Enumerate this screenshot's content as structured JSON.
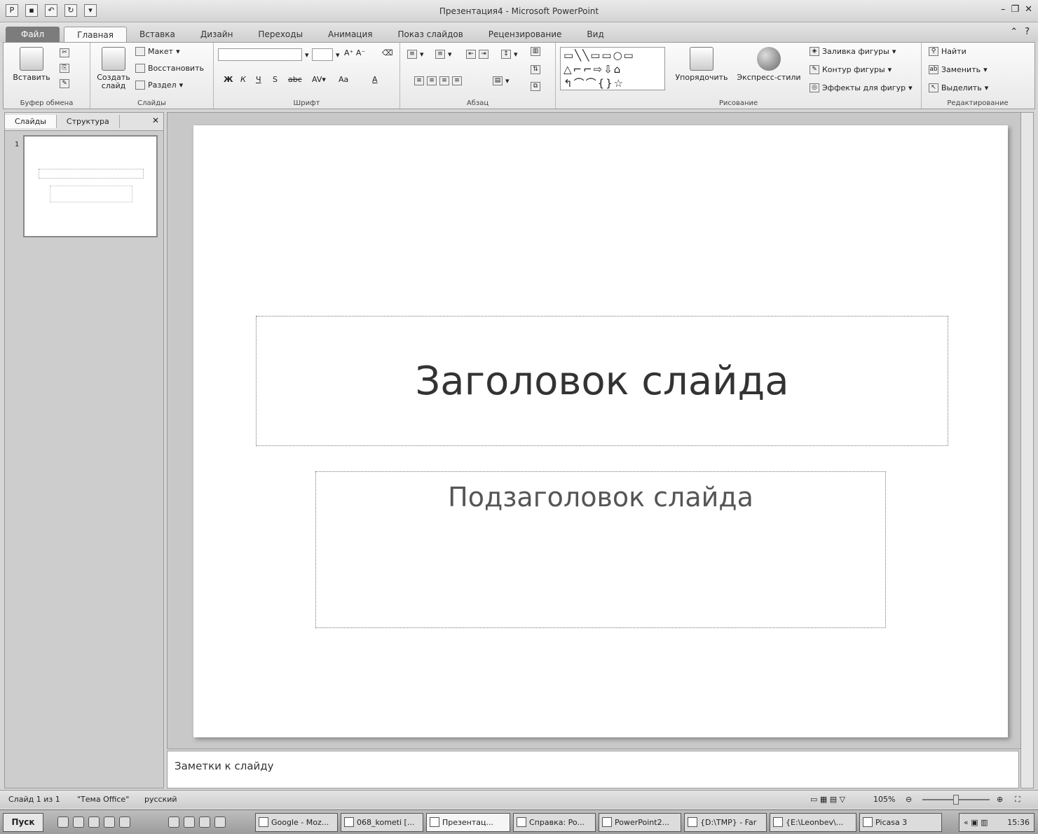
{
  "window": {
    "title": "Презентация4 - Microsoft PowerPoint",
    "controls": [
      "–",
      "❐",
      "✕"
    ]
  },
  "tabs": [
    "Файл",
    "Главная",
    "Вставка",
    "Дизайн",
    "Переходы",
    "Анимация",
    "Показ слайдов",
    "Рецензирование",
    "Вид"
  ],
  "active_tab": "Главная",
  "ribbon": {
    "clipboard": {
      "label": "Буфер обмена",
      "paste": "Вставить"
    },
    "slides": {
      "label": "Слайды",
      "new_slide_line1": "Создать",
      "new_slide_line2": "слайд",
      "layout": "Макет",
      "reset": "Восстановить",
      "section": "Раздел"
    },
    "font": {
      "label": "Шрифт",
      "bold": "Ж",
      "italic": "К",
      "underline": "Ч",
      "strike": "S",
      "change_case": "Аа",
      "font_color": "А"
    },
    "paragraph": {
      "label": "Абзац"
    },
    "drawing": {
      "label": "Рисование",
      "arrange": "Упорядочить",
      "quick_styles": "Экспресс-стили",
      "fill": "Заливка фигуры",
      "outline": "Контур фигуры",
      "effects": "Эффекты для фигур",
      "shapes_glyphs": "▭╲╲▭▭○▭ △⌐⌐⇨⇩⌂ ↰⌒⌒{}☆"
    },
    "editing": {
      "label": "Редактирование",
      "find": "Найти",
      "replace": "Заменить",
      "select": "Выделить"
    }
  },
  "leftpane": {
    "tabs": [
      "Слайды",
      "Структура"
    ],
    "close": "✕",
    "thumb_number": "1"
  },
  "slide": {
    "title_placeholder": "Заголовок слайда",
    "subtitle_placeholder": "Подзаголовок слайда"
  },
  "notes": {
    "placeholder": "Заметки к слайду"
  },
  "status": {
    "slide_info": "Слайд 1 из 1",
    "theme": "\"Тема Office\"",
    "language": "русский",
    "zoom": "105%",
    "zoom_level_percent": 105
  },
  "taskbar": {
    "start": "Пуск",
    "tasks": [
      "Google - Moz...",
      "068_kometi [...",
      "Презентац...",
      "Справка: Po...",
      "PowerPoint2...",
      "{D:\\TMP} - Far",
      "{E:\\Leonbev\\...",
      "Picasa 3"
    ],
    "active_task_index": 2,
    "clock": "15:36"
  }
}
